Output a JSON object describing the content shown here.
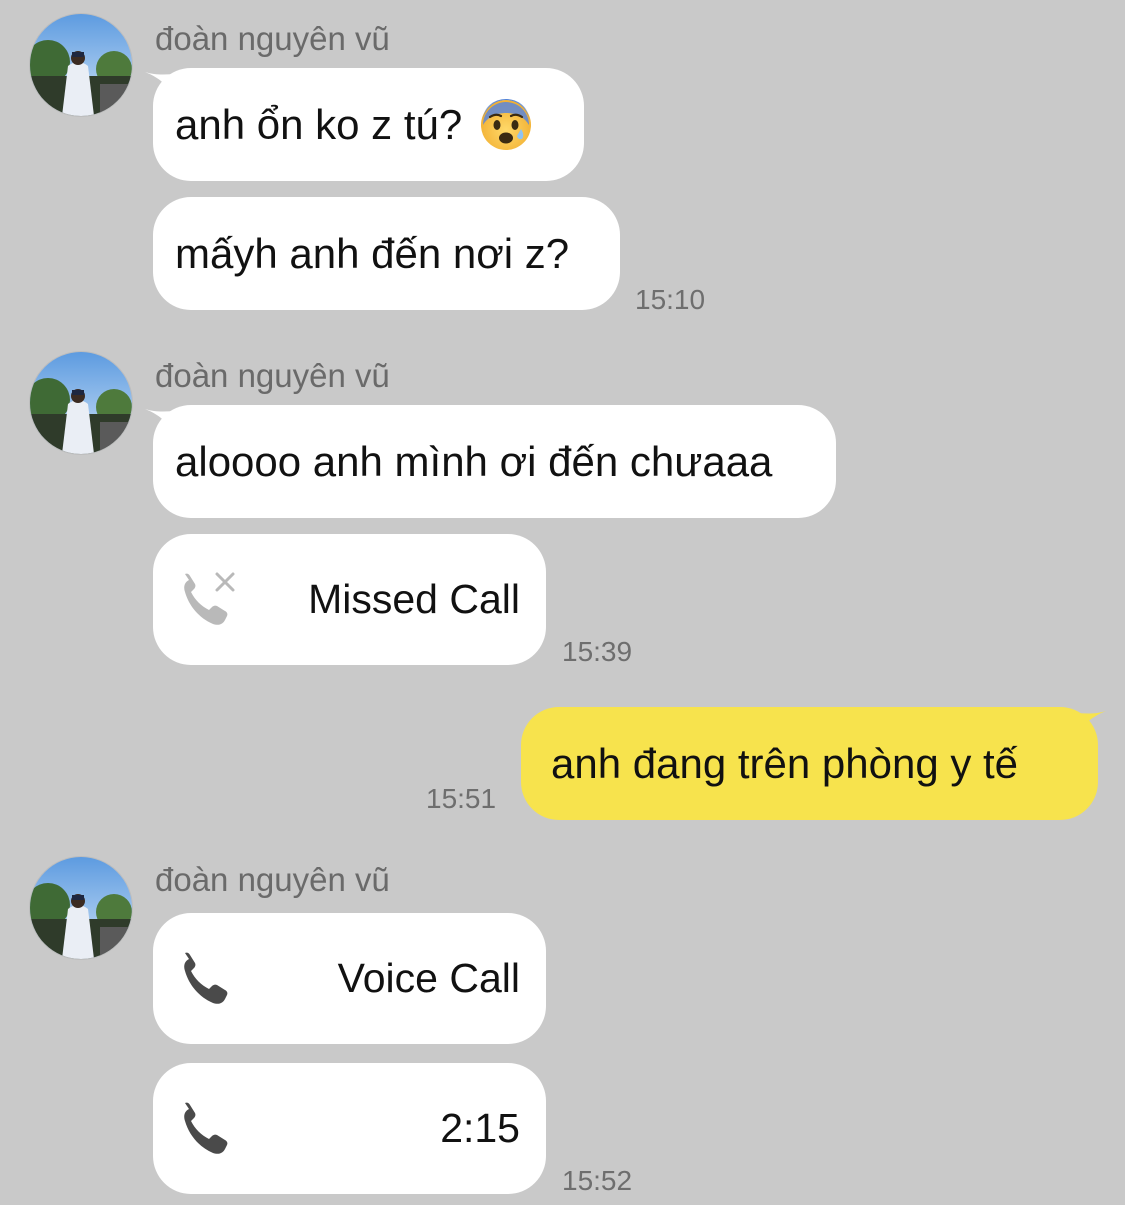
{
  "messages": [
    {
      "sender": "đoàn nguyên vũ",
      "bubbles": [
        {
          "text": "anh ổn ko z tú?",
          "emoji": "anxious-face-with-sweat-emoji"
        },
        {
          "text": "mấyh anh đến nơi z?"
        }
      ],
      "time": "15:10"
    },
    {
      "sender": "đoàn nguyên vũ",
      "bubbles": [
        {
          "text": "aloooo anh mình ơi đến chưaaa"
        },
        {
          "call_type": "missed",
          "label": "Missed Call",
          "icon": "missed-call-icon"
        }
      ],
      "time": "15:39"
    },
    {
      "sender": "me",
      "bubbles": [
        {
          "text": "anh đang trên phòng y tế"
        }
      ],
      "time": "15:51"
    },
    {
      "sender": "đoàn nguyên vũ",
      "bubbles": [
        {
          "call_type": "voice",
          "label": "Voice Call",
          "icon": "phone-icon"
        },
        {
          "call_type": "duration",
          "label": "2:15",
          "icon": "phone-icon"
        }
      ],
      "time": "15:52"
    }
  ],
  "colors": {
    "background": "#c9c9c9",
    "incoming_bubble": "#ffffff",
    "outgoing_bubble": "#f7e34d"
  }
}
